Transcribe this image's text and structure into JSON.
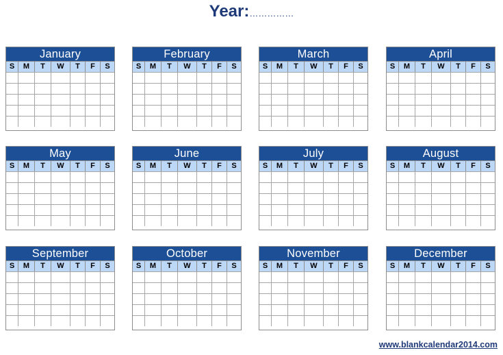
{
  "header": {
    "label": "Year:",
    "dots": "……………"
  },
  "weekdays": [
    "S",
    "M",
    "T",
    "W",
    "T",
    "F",
    "S"
  ],
  "months": [
    "January",
    "February",
    "March",
    "April",
    "May",
    "June",
    "July",
    "August",
    "September",
    "October",
    "November",
    "December"
  ],
  "footer": {
    "link": "www.blankcalendar2014.com"
  },
  "colors": {
    "header_bg": "#1c4f95",
    "weekday_bg": "#bdd7f6",
    "title": "#1f3a78"
  }
}
